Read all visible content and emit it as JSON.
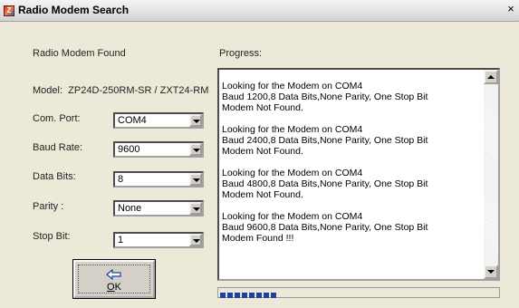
{
  "window": {
    "title": "Radio Modem Search",
    "app_icon": "Z"
  },
  "status": {
    "found_label": "Radio Modem Found",
    "model_label": "Model:",
    "model_value": "ZP24D-250RM-SR / ZXT24-RM"
  },
  "fields": [
    {
      "label": "Com. Port:",
      "value": "COM4"
    },
    {
      "label": "Baud Rate:",
      "value": "9600"
    },
    {
      "label": "Data Bits:",
      "value": "8"
    },
    {
      "label": "Parity :",
      "value": "None"
    },
    {
      "label": "Stop Bit:",
      "value": "1"
    }
  ],
  "ok_button": {
    "mnemonic": "O",
    "rest": "K"
  },
  "progress": {
    "label": "Progress:",
    "log": [
      [
        "Looking for the Modem on COM4",
        "Baud 1200,8 Data Bits,None Parity, One Stop Bit",
        "Modem Not Found."
      ],
      [
        "Looking for the Modem on COM4",
        "Baud 2400,8 Data Bits,None Parity, One Stop Bit",
        "Modem Not Found."
      ],
      [
        "Looking for the Modem on COM4",
        "Baud 4800,8 Data Bits,None Parity, One Stop Bit",
        "Modem Not Found."
      ],
      [
        "Looking for the Modem on COM4",
        "Baud 9600,8 Data Bits,None Parity, One Stop Bit",
        "Modem Found !!!"
      ]
    ],
    "fraction": 0.22,
    "fill_color": "#1c3fa8"
  },
  "icons": {
    "close": "close-icon",
    "ok": "back-arrow-icon"
  }
}
